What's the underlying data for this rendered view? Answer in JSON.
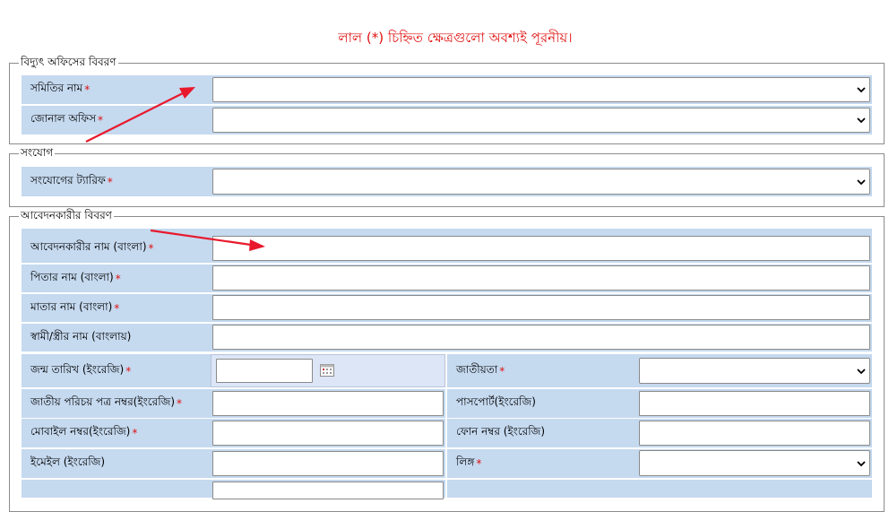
{
  "notice": "লাল (*) চিহ্নিত ক্ষেত্রগুলো অবশ্যই পূরনীয়।",
  "required_mark": "*",
  "sections": {
    "office": {
      "legend": "বিদ্যুৎ অফিসের বিবরণ",
      "somiti_label": "সমিতির নাম",
      "zonal_label": "জোনাল অফিস"
    },
    "connection": {
      "legend": "সংযোগ",
      "tariff_label": "সংযোগের ট্যারিফ"
    },
    "applicant": {
      "legend": "আবেদনকারীর বিবরণ",
      "name_label": "আবেদনকারীর নাম (বাংলা)",
      "father_label": "পিতার নাম (বাংলা)",
      "mother_label": "মাতার নাম (বাংলা)",
      "spouse_label": "স্বামী/স্ত্রীর নাম (বাংলায়)",
      "dob_label": "জন্ম তারিখ (ইংরেজি)",
      "nationality_label": "জাতীয়তা",
      "nid_label": "জাতীয় পরিচয় পত্র নম্বর(ইংরেজি)",
      "passport_label": "পাসপোর্ট(ইংরেজি)",
      "mobile_label": "মোবাইল নম্বর(ইংরেজি)",
      "phone_label": "ফোন নম্বর (ইংরেজি)",
      "email_label": "ইমেইল (ইংরেজি)",
      "gender_label": "লিঙ্গ"
    }
  },
  "colors": {
    "accent_red": "#e01010",
    "label_bg": "#c5d9ef",
    "arrow": "#e8192c"
  },
  "icons": [
    "chevron-down-icon",
    "calendar-icon",
    "red-arrow-annotation"
  ]
}
